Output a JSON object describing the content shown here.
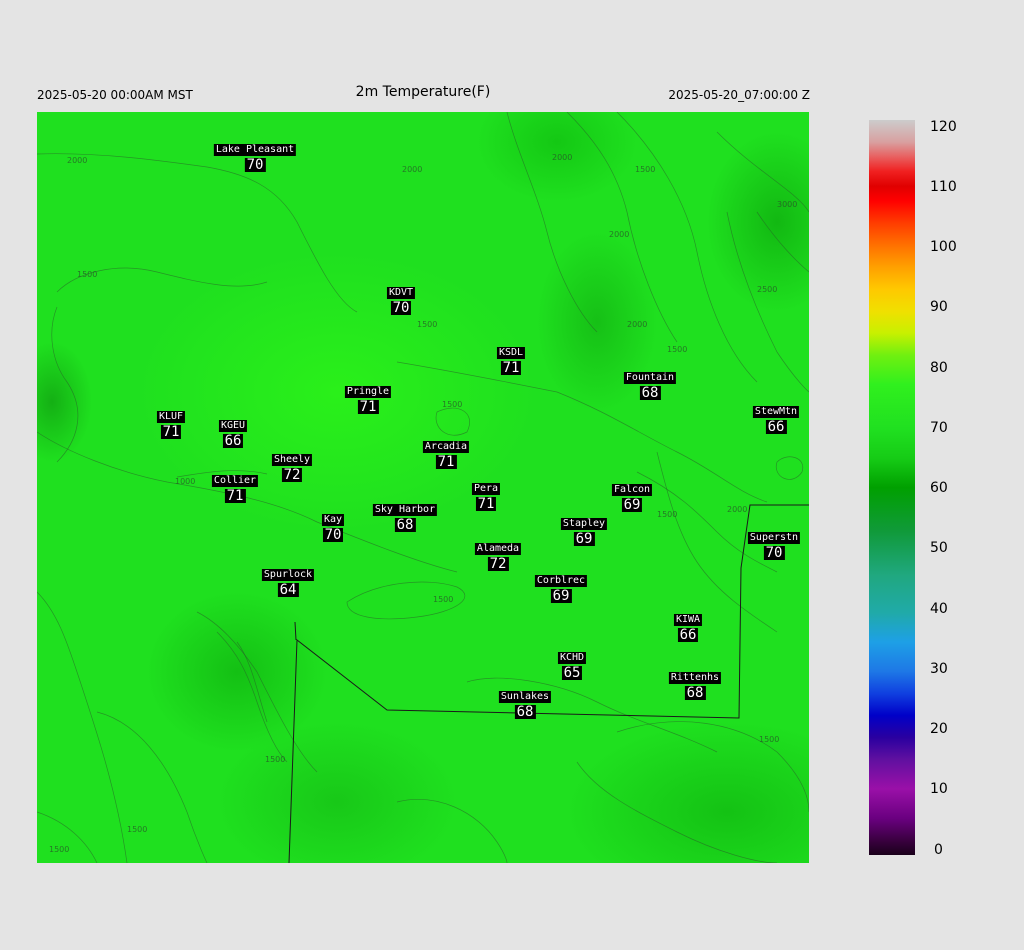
{
  "header": {
    "local_time": "2025-05-20 00:00AM MST",
    "title": "2m Temperature(F)",
    "utc_time": "2025-05-20_07:00:00 Z"
  },
  "contour_labels": [
    "2000",
    "1500",
    "1000",
    "2500",
    "3000"
  ],
  "stations": [
    {
      "name": "Lake Pleasant",
      "value": "70"
    },
    {
      "name": "KDVT",
      "value": "70"
    },
    {
      "name": "KSDL",
      "value": "71"
    },
    {
      "name": "Fountain",
      "value": "68"
    },
    {
      "name": "Pringle",
      "value": "71"
    },
    {
      "name": "KLUF",
      "value": "71"
    },
    {
      "name": "KGEU",
      "value": "66"
    },
    {
      "name": "StewMtn",
      "value": "66"
    },
    {
      "name": "Arcadia",
      "value": "71"
    },
    {
      "name": "Sheely",
      "value": "72"
    },
    {
      "name": "Collier",
      "value": "71"
    },
    {
      "name": "Pera",
      "value": "71"
    },
    {
      "name": "Falcon",
      "value": "69"
    },
    {
      "name": "Kay",
      "value": "70"
    },
    {
      "name": "Sky Harbor",
      "value": "68"
    },
    {
      "name": "Stapley",
      "value": "69"
    },
    {
      "name": "Superstn",
      "value": "70"
    },
    {
      "name": "Alameda",
      "value": "72"
    },
    {
      "name": "Spurlock",
      "value": "64"
    },
    {
      "name": "Corblrec",
      "value": "69"
    },
    {
      "name": "KIWA",
      "value": "66"
    },
    {
      "name": "KCHD",
      "value": "65"
    },
    {
      "name": "Rittenhs",
      "value": "68"
    },
    {
      "name": "Sunlakes",
      "value": "68"
    }
  ],
  "colorbar": {
    "ticks": [
      "120",
      "110",
      "100",
      "90",
      "80",
      "70",
      "60",
      "50",
      "40",
      "30",
      "20",
      "10",
      "0"
    ]
  }
}
